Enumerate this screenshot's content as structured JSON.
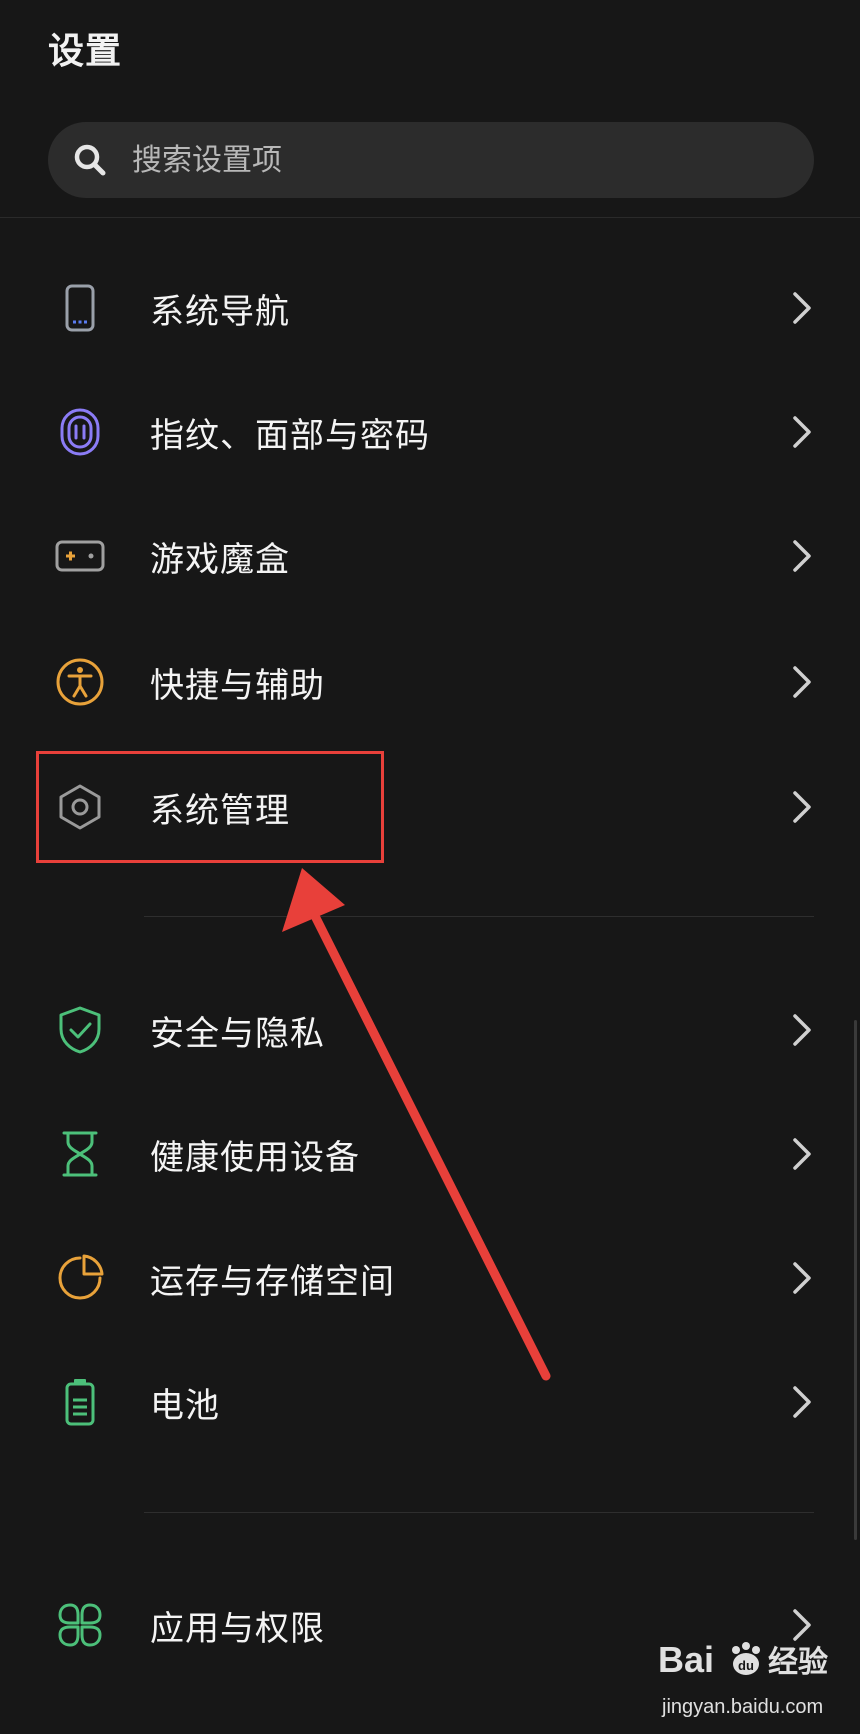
{
  "header": {
    "title": "设置"
  },
  "search": {
    "placeholder": "搜索设置项"
  },
  "groups": [
    {
      "items": [
        {
          "label": "系统导航",
          "icon": "phone-navigation-icon"
        },
        {
          "label": "指纹、面部与密码",
          "icon": "fingerprint-icon"
        },
        {
          "label": "游戏魔盒",
          "icon": "gamepad-icon"
        },
        {
          "label": "快捷与辅助",
          "icon": "accessibility-icon"
        },
        {
          "label": "系统管理",
          "icon": "hexagon-settings-icon"
        }
      ]
    },
    {
      "items": [
        {
          "label": "安全与隐私",
          "icon": "shield-check-icon"
        },
        {
          "label": "健康使用设备",
          "icon": "hourglass-icon"
        },
        {
          "label": "运存与存储空间",
          "icon": "pie-chart-icon"
        },
        {
          "label": "电池",
          "icon": "battery-icon"
        }
      ]
    },
    {
      "items": [
        {
          "label": "应用与权限",
          "icon": "apps-grid-icon"
        }
      ]
    }
  ],
  "annotation": {
    "highlighted_item": "系统管理",
    "color": "#e8403a"
  },
  "colors": {
    "background": "#171717",
    "navigation": "#9aa0aa",
    "fingerprint": "#8b7cf6",
    "game": "#d6a14a",
    "accessibility": "#e8a23a",
    "system": "#9a9a9a",
    "security": "#4cc07a",
    "health": "#4cc07a",
    "storage": "#e8a23a",
    "battery": "#4cc07a",
    "apps": "#4cc07a"
  },
  "watermark": {
    "url": "jingyan.baidu.com"
  }
}
